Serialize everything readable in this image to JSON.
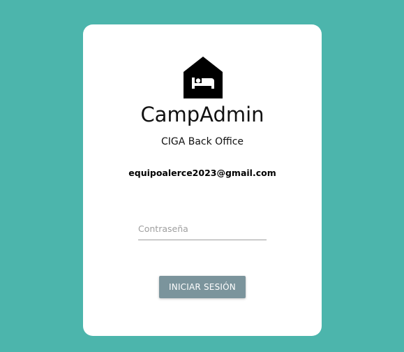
{
  "app": {
    "title": "CampAdmin",
    "subtitle": "CIGA Back Office",
    "logo_icon": "house-bed-icon"
  },
  "login": {
    "email": "equipoalerce2023@gmail.com",
    "password_placeholder": "Contraseña",
    "password_value": "",
    "submit_label": "INICIAR SESIÓN"
  },
  "colors": {
    "background": "#4cb5ac",
    "card": "#ffffff",
    "button": "#7b949c",
    "button_text": "#ffffff"
  }
}
